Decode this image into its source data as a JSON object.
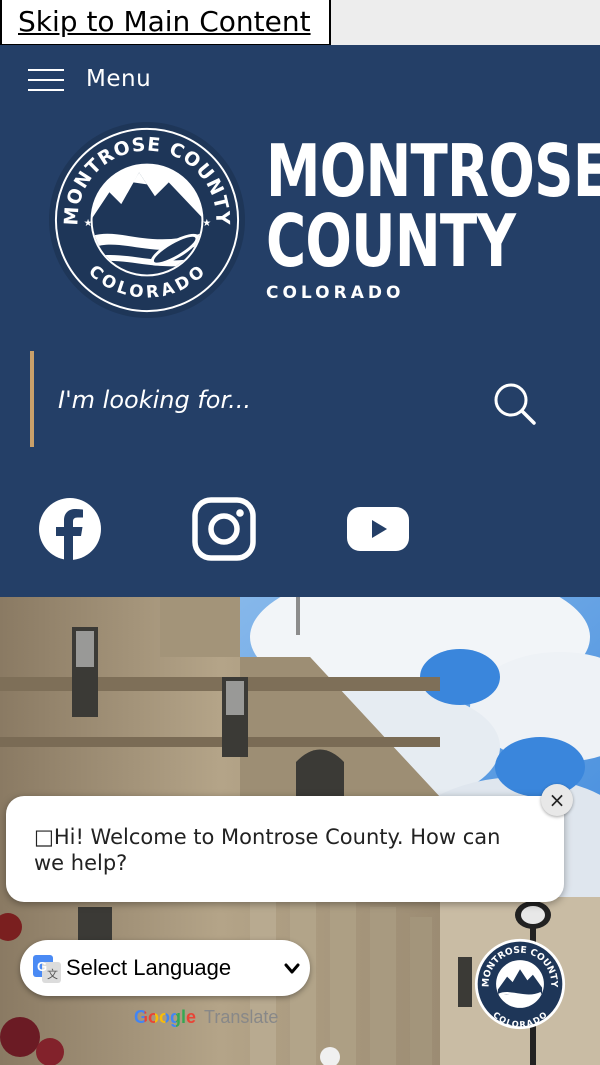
{
  "skip_link": {
    "label": "Skip to Main Content"
  },
  "header": {
    "menu_label": "Menu",
    "logo": {
      "seal_top_text": "MONTROSE COUNTY",
      "seal_bottom_text": "COLORADO",
      "wordmark_line1": "MONTROSE",
      "wordmark_line2": "COUNTY",
      "wordmark_line3": "COLORADO"
    },
    "search": {
      "placeholder": "I'm looking for..."
    },
    "social": [
      "facebook-icon",
      "instagram-icon",
      "youtube-icon"
    ]
  },
  "chat": {
    "welcome": "□Hi! Welcome to Montrose County. How can we help?",
    "close": "×"
  },
  "translate": {
    "select_label": "Select Language",
    "powered_google": "Google",
    "powered_translate": "Translate"
  },
  "colors": {
    "header_bg": "#243f67",
    "search_accent": "#c9a06a",
    "sky": "#5aa0e8"
  }
}
